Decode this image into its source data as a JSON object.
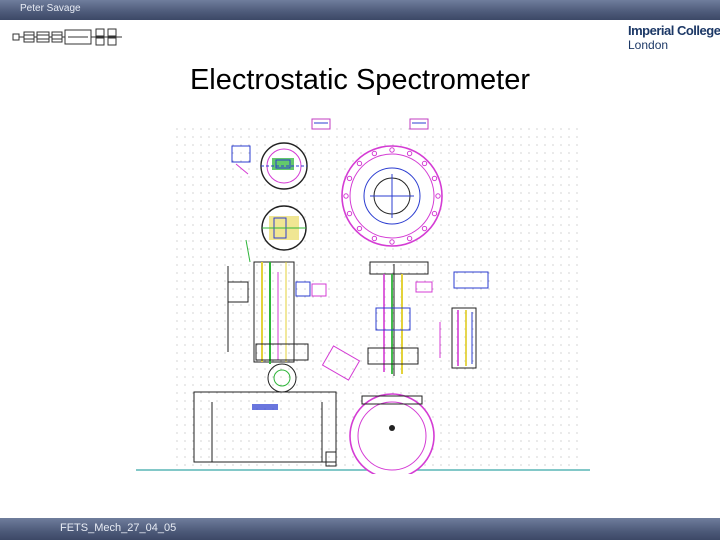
{
  "header": {
    "author": "Peter Savage",
    "institution_name": "Imperial College",
    "institution_city": "London"
  },
  "slide": {
    "title": "Electrostatic Spectrometer"
  },
  "footer": {
    "reference": "FETS_Mech_27_04_05"
  },
  "colors": {
    "bar": "#4d5a79",
    "drawing_magenta": "#d43cd4",
    "drawing_green": "#2fb53a",
    "drawing_yellow": "#e3d23a",
    "drawing_blue": "#2b3cd0",
    "baseline": "#59b6b6"
  },
  "icons": {
    "left_logo": "beamline-schematic-icon",
    "right_logo": "imperial-college-logo"
  }
}
